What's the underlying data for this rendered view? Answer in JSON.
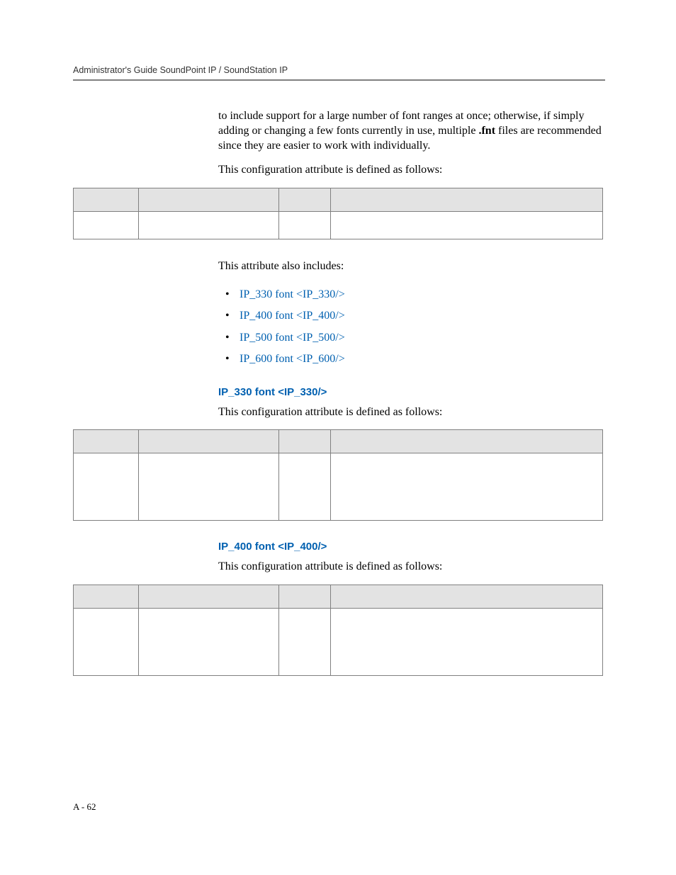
{
  "header": {
    "running_title": "Administrator's Guide SoundPoint IP / SoundStation IP"
  },
  "intro": {
    "para_part1": "to include support for a large number of font ranges at once; otherwise, if simply adding or changing a few fonts currently in use, multiple ",
    "para_bold": ".fnt",
    "para_part2": " files are recommended since they are easier to work with individually.",
    "config_line": "This configuration attribute is defined as follows:"
  },
  "includes": {
    "intro": "This attribute also includes:",
    "items": [
      "IP_330 font <IP_330/>",
      "IP_400 font <IP_400/>",
      "IP_500 font <IP_500/>",
      "IP_600 font <IP_600/>"
    ]
  },
  "section_ip330": {
    "heading": "IP_330 font <IP_330/>",
    "config_line": "This configuration attribute is defined as follows:"
  },
  "section_ip400": {
    "heading": "IP_400 font <IP_400/>",
    "config_line": "This configuration attribute is defined as follows:"
  },
  "footer": {
    "page_number": "A - 62"
  }
}
